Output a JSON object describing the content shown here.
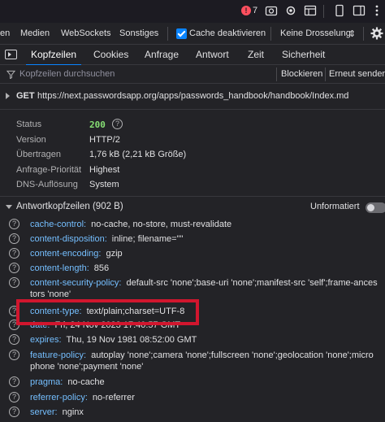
{
  "topbar": {
    "error_count": "7",
    "error_symbol": "!"
  },
  "netbar": {
    "items": [
      "en",
      "Medien",
      "WebSockets",
      "Sonstiges"
    ],
    "cache_label": "Cache deaktivieren",
    "throttle_label": "Keine Drosselung",
    "throttle_arrow": "⇕"
  },
  "tabs": [
    "Kopfzeilen",
    "Cookies",
    "Anfrage",
    "Antwort",
    "Zeit",
    "Sicherheit"
  ],
  "filter": {
    "placeholder": "Kopfzeilen durchsuchen",
    "block_label": "Blockieren",
    "resend_label": "Erneut sender"
  },
  "request": {
    "method": "GET",
    "url": "https://next.passwordsapp.org/apps/passwords_handbook/handbook/Index.md"
  },
  "status_block": [
    {
      "key": "Status",
      "value": "200"
    },
    {
      "key": "Version",
      "value": "HTTP/2"
    },
    {
      "key": "Übertragen",
      "value": "1,76 kB (2,21 kB Größe)"
    },
    {
      "key": "Anfrage-Priorität",
      "value": "Highest"
    },
    {
      "key": "DNS-Auflösung",
      "value": "System"
    }
  ],
  "help_symbol": "?",
  "response_section": {
    "title": "Antwortkopfzeilen (902 B)",
    "raw_label": "Unformatiert"
  },
  "headers": [
    {
      "name": "cache-control:",
      "value": "no-cache, no-store, must-revalidate"
    },
    {
      "name": "content-disposition:",
      "value": "inline; filename=\"\""
    },
    {
      "name": "content-encoding:",
      "value": "gzip"
    },
    {
      "name": "content-length:",
      "value": "856"
    },
    {
      "name": "content-security-policy:",
      "value": "default-src 'none';base-uri 'none';manifest-src 'self';frame-ances",
      "cont": "tors 'none'"
    },
    {
      "name": "content-type:",
      "value": "text/plain;charset=UTF-8"
    },
    {
      "name": "date:",
      "value": "Fri, 24 Nov 2023 17:40:57 GMT"
    },
    {
      "name": "expires:",
      "value": "Thu, 19 Nov 1981 08:52:00 GMT"
    },
    {
      "name": "feature-policy:",
      "value": "autoplay 'none';camera 'none';fullscreen 'none';geolocation 'none';micro",
      "cont": "phone 'none';payment 'none'"
    },
    {
      "name": "pragma:",
      "value": "no-cache"
    },
    {
      "name": "referrer-policy:",
      "value": "no-referrer"
    },
    {
      "name": "server:",
      "value": "nginx"
    }
  ]
}
